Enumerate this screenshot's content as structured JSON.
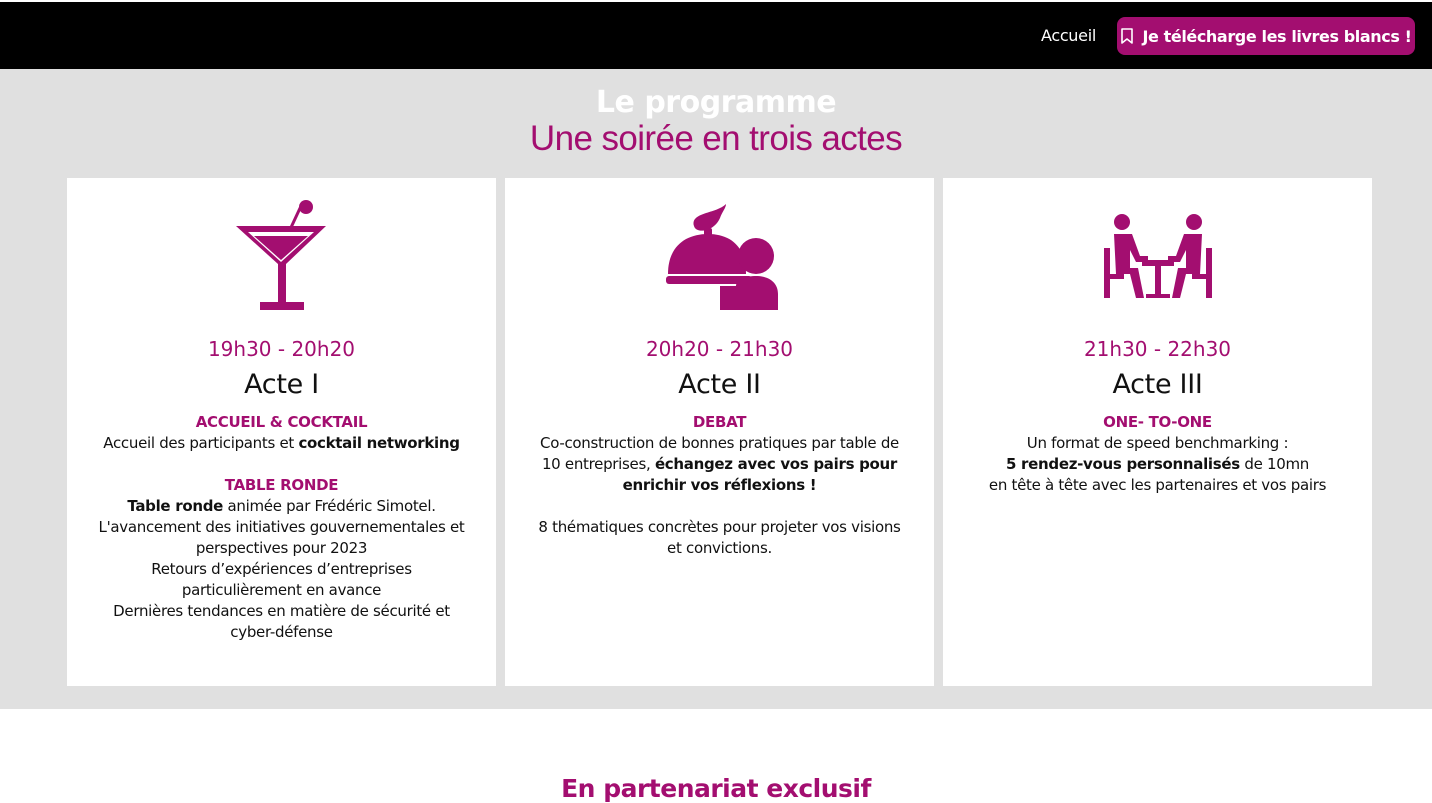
{
  "nav": {
    "home_label": "Accueil",
    "cta_label": "Je télécharge les livres blancs !",
    "cta_icon": "bookmark-icon"
  },
  "programme": {
    "title": "Le programme",
    "subtitle": "Une soirée en trois actes"
  },
  "acts": [
    {
      "icon": "cocktail-icon",
      "time": "19h30 - 20h20",
      "title": "Acte I",
      "h1": "ACCUEIL & COCKTAIL",
      "p1a": "Accueil des participants et ",
      "p1b": "cocktail networking",
      "h2": "TABLE RONDE",
      "p2a": "Table ronde",
      "p2b": " animée par Frédéric Simotel.",
      "p3": "L'avancement des initiatives gouvernementales et perspectives pour 2023",
      "p4": "Retours d’expériences d’entreprises particulièrement en avance",
      "p5": "Dernières tendances en matière de sécurité et cyber-défense"
    },
    {
      "icon": "dining-icon",
      "time": "20h20 - 21h30",
      "title": "Acte II",
      "h1": "DEBAT",
      "p1a": "Co-construction de bonnes pratiques par table de 10 entreprises, ",
      "p1b": "échangez avec vos pairs pour enrichir vos réflexions !",
      "p2": "8 thématiques concrètes pour projeter vos visions et convictions."
    },
    {
      "icon": "meeting-icon",
      "time": "21h30 - 22h30",
      "title": "Acte III",
      "h1": "ONE- TO-ONE",
      "p1": "Un format de speed benchmarking :",
      "p2a": "5 rendez-vous personnalisés",
      "p2b": " de 10mn",
      "p3": "en tête à tête avec les partenaires et vos pairs"
    }
  ],
  "partner": {
    "title": "En partenariat exclusif"
  },
  "colors": {
    "accent": "#a30e70",
    "header_bg": "#000000",
    "section_bg": "#e0e0e0"
  }
}
